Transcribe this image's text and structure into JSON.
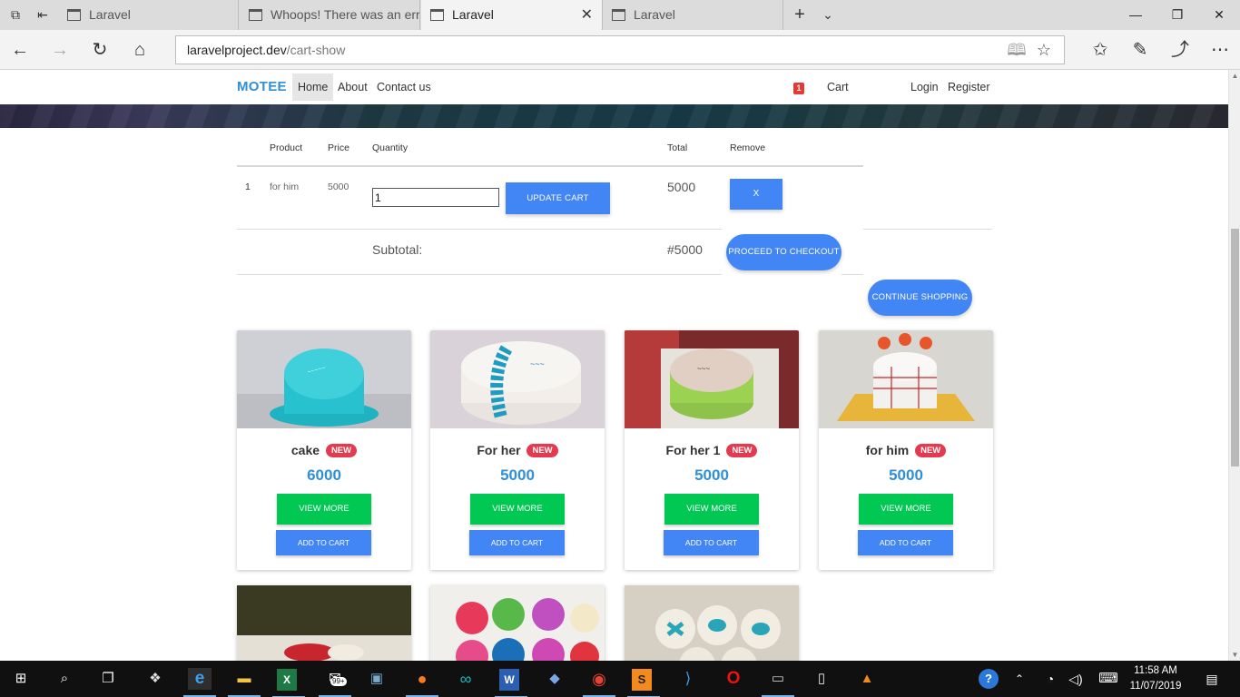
{
  "browser": {
    "tabs": [
      {
        "title": "Laravel"
      },
      {
        "title": "Whoops! There was an erro"
      },
      {
        "title": "Laravel",
        "active": true
      },
      {
        "title": "Laravel"
      }
    ],
    "address": {
      "host": "laravelproject.dev",
      "path": "/cart-show"
    }
  },
  "site": {
    "brand": "MOTEE",
    "nav": [
      "Home",
      "About",
      "Contact us"
    ],
    "cart_count": "1",
    "cart_label": "Cart",
    "login": "Login",
    "register": "Register"
  },
  "cart": {
    "headers": {
      "product": "Product",
      "price": "Price",
      "quantity": "Quantity",
      "total": "Total",
      "remove": "Remove"
    },
    "rows": [
      {
        "index": "1",
        "product": "for him",
        "price": "5000",
        "quantity": "1",
        "total": "5000"
      }
    ],
    "update_button": "UPDATE CART",
    "remove_button": "X",
    "subtotal_label": "Subtotal:",
    "subtotal_value": "#5000",
    "checkout_button": "PROCEED TO CHECKOUT",
    "continue_button": "CONTINUE SHOPPING"
  },
  "products": [
    {
      "name": "cake",
      "badge": "NEW",
      "price": "6000",
      "view_more": "VIEW MORE",
      "add_to_cart": "ADD TO CART"
    },
    {
      "name": "For her",
      "badge": "NEW",
      "price": "5000",
      "view_more": "VIEW MORE",
      "add_to_cart": "ADD TO CART"
    },
    {
      "name": "For her 1",
      "badge": "NEW",
      "price": "5000",
      "view_more": "VIEW MORE",
      "add_to_cart": "ADD TO CART"
    },
    {
      "name": "for him",
      "badge": "NEW",
      "price": "5000",
      "view_more": "VIEW MORE",
      "add_to_cart": "ADD TO CART"
    }
  ],
  "taskbar": {
    "time": "11:58 AM",
    "date": "11/07/2019",
    "mail_badge": "99+"
  },
  "colors": {
    "accent_blue": "#4285f4",
    "brand_blue": "#2f8fd8",
    "view_more_green": "#00c853",
    "new_badge_red": "#e53950"
  }
}
